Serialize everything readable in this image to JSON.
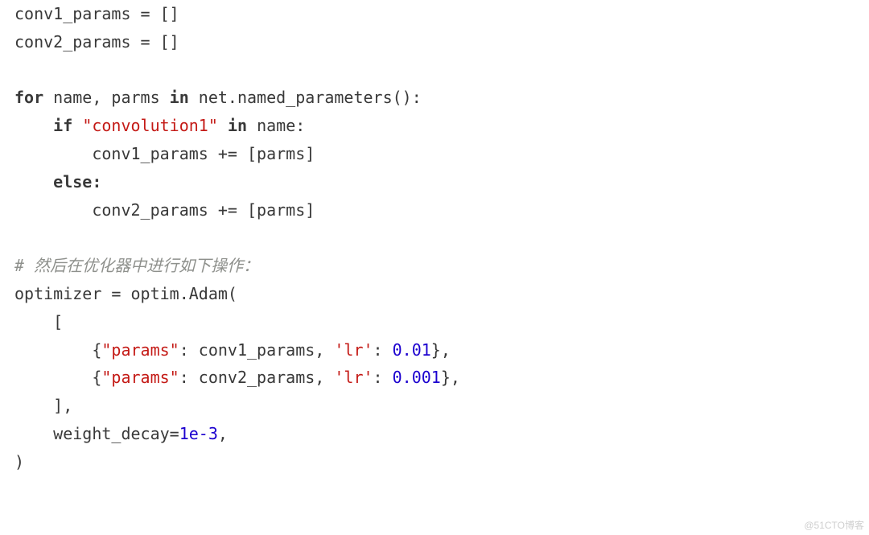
{
  "lines": {
    "0": "conv1_params = []",
    "1": "conv2_params = []",
    "2": "",
    "5": "        conv1_params += [parms]",
    "7": "        conv2_params += [parms]",
    "8": "",
    "9": "# 然后在优化器中进行如下操作：",
    "10": "optimizer = optim.Adam(",
    "11": "    [",
    "14": "    ],",
    "16": ")"
  },
  "kw": {
    "for_": "for",
    "in_": "in",
    "if_": "if",
    "else_": "else:"
  },
  "str": {
    "conv1": "\"convolution1\"",
    "params": "\"params\"",
    "lr": "'lr'"
  },
  "num": {
    "a": "0.01",
    "b": "0.001",
    "wd": "1e-3"
  },
  "t": {
    "for_mid": " name, parms ",
    "for_end": " net.named_parameters():",
    "if_end": " name:",
    "ind1": "    ",
    "ind2": "        ",
    "sp": " ",
    "brace_o": "{",
    "brace_c": "},",
    "p1a": ": conv1_params, ",
    "p1b": ": conv2_params, ",
    "colon_sp": ": ",
    "wd": "    weight_decay=",
    "comma": ","
  },
  "watermark": "@51CTO博客"
}
